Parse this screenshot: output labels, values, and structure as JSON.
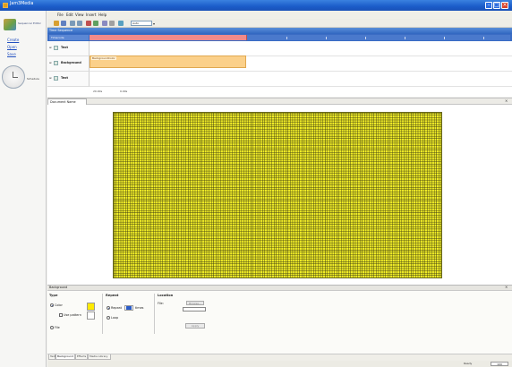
{
  "app": {
    "title": "Jam3Media"
  },
  "left_pane": {
    "logo_text": "Sequencer Editor",
    "links": [
      "Create",
      "Open",
      "Save"
    ],
    "clock_label": "Schedule"
  },
  "menu": {
    "items": [
      "File",
      "Edit",
      "View",
      "Insert",
      "Help"
    ]
  },
  "toolbar": {
    "zoom_value": "Auto"
  },
  "timeline": {
    "header_title": "Time Sequence",
    "controls_label": "Timecode",
    "tracks": [
      {
        "name": "Text"
      },
      {
        "name": "Background"
      },
      {
        "name": "Text"
      }
    ],
    "clip_label": "BackgroundColor",
    "time_a": "20.00s",
    "time_b": "0.00s"
  },
  "editor": {
    "tab_label": "Document Name",
    "canvas_color": "#f0ec28"
  },
  "properties": {
    "header_title": "Background",
    "type_group": {
      "title": "Type",
      "color_label": "Color",
      "pattern_label": "Use pattern",
      "none_label": "File"
    },
    "repeat_group": {
      "title": "Repeat",
      "repeat_label": "Repeat",
      "times_label": "times",
      "loop_label": "Loop"
    },
    "location_group": {
      "title": "Location",
      "file_label": "File:",
      "browse_label": "Browse...",
      "apply_label": "Apply"
    }
  },
  "bottom_tabs": [
    "Text",
    "Background",
    "Effects",
    "Media Library"
  ],
  "status": {
    "text": "Ready",
    "value": "100"
  },
  "colors": {
    "titlebar": "#1b5cc9",
    "timeline_header": "#3a6cc4",
    "clip": "#fbd08a",
    "swatch": "#ffea00"
  }
}
